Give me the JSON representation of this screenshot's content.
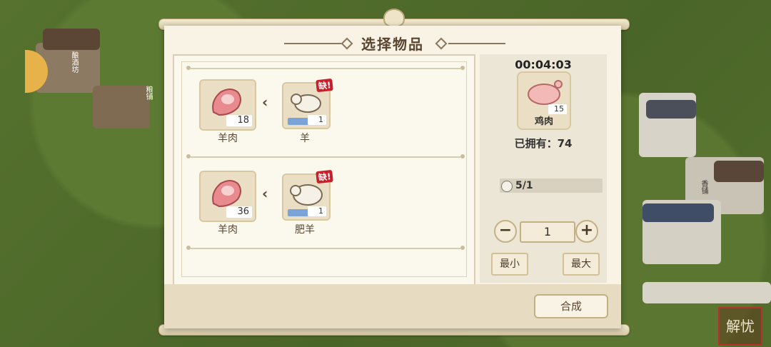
{
  "dialog": {
    "title": "选择物品"
  },
  "recipes": [
    {
      "output": {
        "name": "羊肉",
        "count": "18"
      },
      "input": {
        "name": "羊",
        "count": "1",
        "lack_badge": "缺!"
      }
    },
    {
      "output": {
        "name": "羊肉",
        "count": "36"
      },
      "input": {
        "name": "肥羊",
        "count": "1",
        "lack_badge": "缺!"
      }
    }
  ],
  "detail": {
    "timer": "00:04:03",
    "item_name": "鸡肉",
    "item_count": "15",
    "owned_text": "已拥有：74",
    "requirement": "5/1",
    "quantity": "1",
    "min_label": "最小",
    "max_label": "最大",
    "minus_label": "−",
    "plus_label": "+"
  },
  "footer": {
    "compose_label": "合成"
  },
  "background": {
    "seal_text": "解忧",
    "building_label_1": "酿酒坊",
    "building_label_2": "粮铺",
    "building_label_3": "香铺"
  }
}
